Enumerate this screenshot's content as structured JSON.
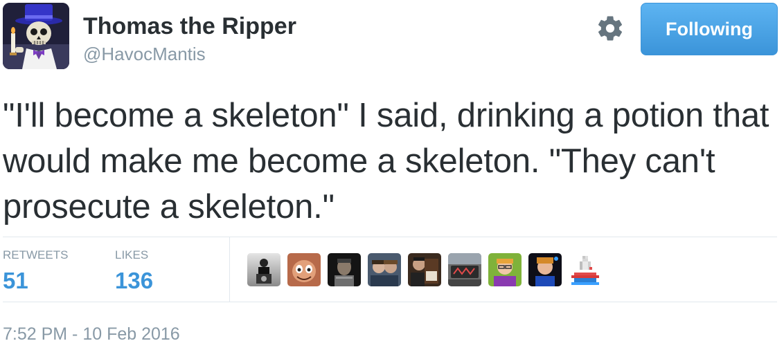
{
  "author": {
    "display_name": "Thomas the Ripper",
    "screen_name": "@HavocMantis",
    "avatar_icon": "skeleton-top-hat-avatar"
  },
  "actions": {
    "settings_icon": "gear-icon",
    "follow_label": "Following",
    "follow_color": "#55acee"
  },
  "tweet": {
    "text": "\"I'll become a skeleton\" I said, drinking a potion that would make me become a skeleton. \"They can't prosecute a skeleton.\""
  },
  "stats": {
    "retweets_label": "RETWEETS",
    "retweets_count": "51",
    "likes_label": "LIKES",
    "likes_count": "136",
    "count_color": "#3b94d9"
  },
  "likers": [
    {
      "icon": "liker-avatar-1"
    },
    {
      "icon": "liker-avatar-2"
    },
    {
      "icon": "liker-avatar-3"
    },
    {
      "icon": "liker-avatar-4"
    },
    {
      "icon": "liker-avatar-5"
    },
    {
      "icon": "liker-avatar-6"
    },
    {
      "icon": "liker-avatar-7"
    },
    {
      "icon": "liker-avatar-8"
    },
    {
      "icon": "liker-avatar-9"
    }
  ],
  "timestamp": "7:52 PM - 10 Feb 2016"
}
